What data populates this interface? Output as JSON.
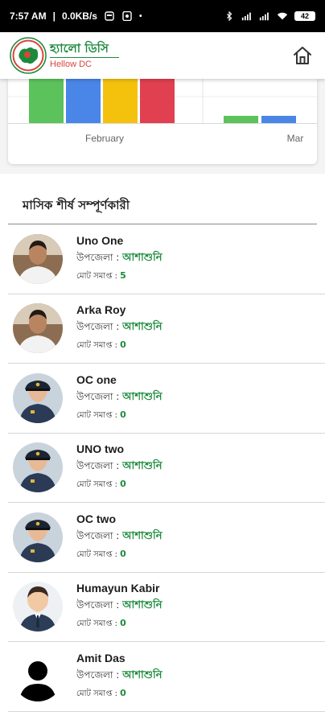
{
  "status_bar": {
    "time": "7:57 AM",
    "speed": "0.0KB/s",
    "battery": "42"
  },
  "app": {
    "title": "হ্যালো ডিসি",
    "subtitle": "Hellow DC",
    "brand_green": "#1b8a3c",
    "brand_red": "#d9453b"
  },
  "chart_data": {
    "type": "bar",
    "categories": [
      "February",
      "Mar"
    ],
    "series": [
      {
        "color": "#5cc25c",
        "values": [
          100,
          12
        ]
      },
      {
        "color": "#4a86e8",
        "values": [
          100,
          12
        ]
      },
      {
        "color": "#f4c20d",
        "values": [
          100,
          0
        ]
      },
      {
        "color": "#e0404f",
        "values": [
          100,
          0
        ]
      }
    ],
    "ylim": [
      0,
      100
    ],
    "grid": true
  },
  "leaders": {
    "title": "মাসিক শীর্ষ সম্পূর্ণকারী",
    "upazila_label": "উপজেলা :",
    "total_label": "মোট সমাপ্ত :",
    "items": [
      {
        "name": "Uno One",
        "upazila": "আশাশুনি",
        "total": "5",
        "avatar": "person-photo"
      },
      {
        "name": "Arka Roy",
        "upazila": "আশাশুনি",
        "total": "0",
        "avatar": "person-photo"
      },
      {
        "name": "OC one",
        "upazila": "আশাশুনি",
        "total": "0",
        "avatar": "police-officer"
      },
      {
        "name": "UNO two",
        "upazila": "আশাশুনি",
        "total": "0",
        "avatar": "police-officer"
      },
      {
        "name": "OC two",
        "upazila": "আশাশুনি",
        "total": "0",
        "avatar": "police-officer"
      },
      {
        "name": "Humayun Kabir",
        "upazila": "আশাশুনি",
        "total": "0",
        "avatar": "businessman"
      },
      {
        "name": "Amit Das",
        "upazila": "আশাশুনি",
        "total": "0",
        "avatar": "silhouette"
      }
    ]
  }
}
